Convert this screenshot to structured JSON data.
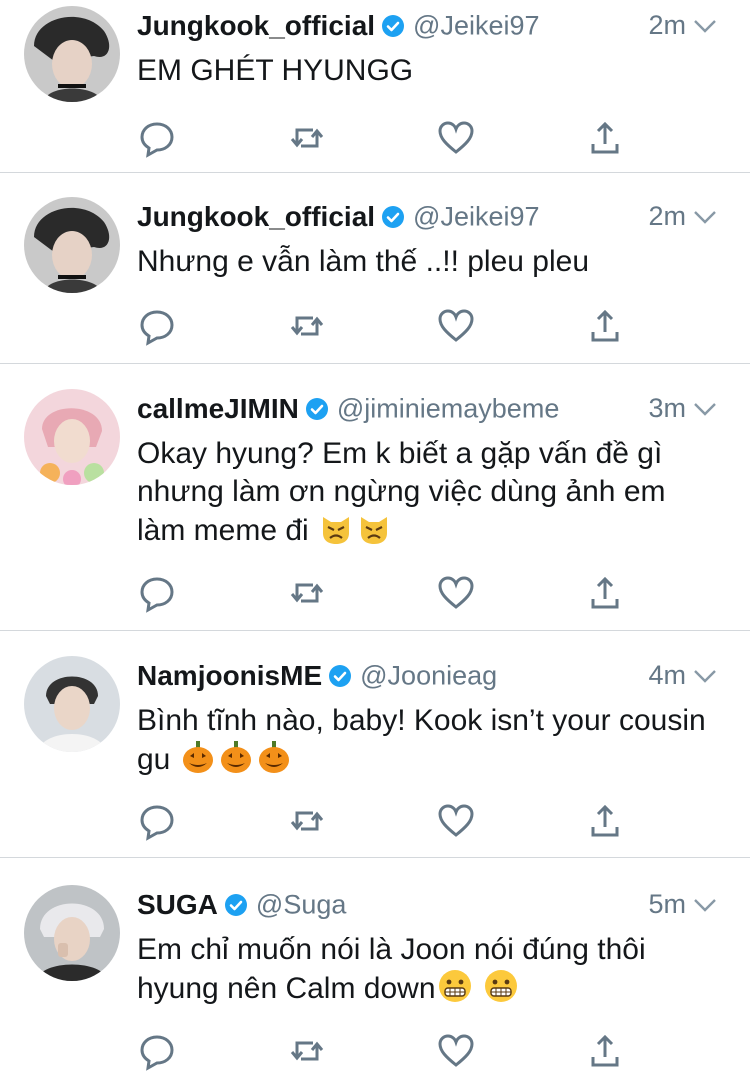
{
  "tweets": [
    {
      "name": "Jungkook_official",
      "handle": "@Jeikei97",
      "time": "2m",
      "text": "EM GHÉT HYUNGG",
      "avatar_icon": "avatar-jungkook",
      "emojis": []
    },
    {
      "name": "Jungkook_official",
      "handle": "@Jeikei97",
      "time": "2m",
      "text": "Nhưng e vẫn làm thế ..!! pleu pleu",
      "avatar_icon": "avatar-jungkook",
      "emojis": []
    },
    {
      "name": "callmeJIMIN",
      "handle": "@jiminiemaybeme",
      "time": "3m",
      "text": "Okay hyung? Em k biết a gặp vấn đề gì nhưng làm ơn ngừng việc dùng ảnh em làm meme đi",
      "avatar_icon": "avatar-jimin",
      "emojis": [
        "angry-cat-emoji",
        "angry-cat-emoji"
      ]
    },
    {
      "name": "NamjoonisME",
      "handle": "@Joonieag",
      "time": "4m",
      "text": "Bình tĩnh nào, baby! Kook isn’t your cousin gu",
      "avatar_icon": "avatar-namjoon",
      "emojis": [
        "jack-o-lantern-emoji",
        "jack-o-lantern-emoji",
        "jack-o-lantern-emoji"
      ]
    },
    {
      "name": "SUGA",
      "handle": "@Suga",
      "time": "5m",
      "text": "Em chỉ muốn nói là Joon nói đúng thôi hyung nên Calm down",
      "avatar_icon": "avatar-suga",
      "emojis": [
        "grimacing-emoji",
        "grimacing-emoji"
      ]
    }
  ],
  "colors": {
    "verified": "#1da1f2",
    "icon_gray": "#657786",
    "text": "#14171a",
    "divider": "#d4d8dc"
  },
  "action_icons": [
    "reply-icon",
    "retweet-icon",
    "like-icon",
    "share-icon"
  ]
}
